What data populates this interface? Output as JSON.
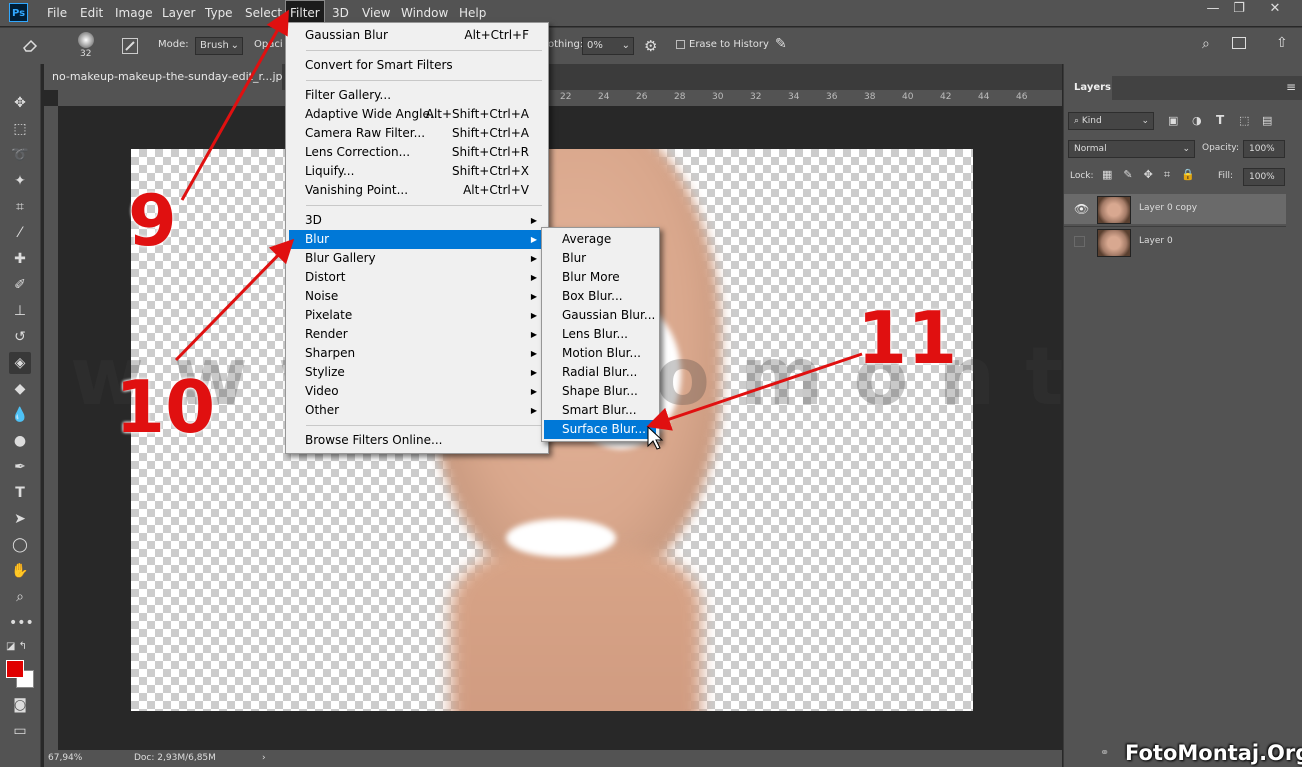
{
  "app": {
    "logo_text": "Ps"
  },
  "menubar": {
    "items": [
      "File",
      "Edit",
      "Image",
      "Layer",
      "Type",
      "Select",
      "Filter",
      "3D",
      "View",
      "Window",
      "Help"
    ],
    "active": "Filter"
  },
  "window_controls": {
    "minimize": "—",
    "restore": "❐",
    "close": "✕"
  },
  "options_bar": {
    "brush_size": "32",
    "mode_label": "Mode:",
    "mode_value": "Brush",
    "opacity_label": "Opaci",
    "smoothing_label": "othing:",
    "smoothing_value": "0%",
    "erase_history_label": "Erase to History"
  },
  "document": {
    "tab_title": "no-makeup-makeup-the-sunday-edit_r...jpg",
    "zoom": "67,94%",
    "doc_info": "Doc: 2,93M/6,85M"
  },
  "ruler_labels": [
    "22",
    "24",
    "26",
    "28",
    "30",
    "32",
    "34",
    "36",
    "38",
    "40",
    "42",
    "44",
    "46"
  ],
  "filter_menu": {
    "items": [
      {
        "label": "Gaussian Blur",
        "shortcut": "Alt+Ctrl+F",
        "submenu": false
      },
      {
        "sep": true
      },
      {
        "label": "Convert for Smart Filters",
        "shortcut": "",
        "submenu": false
      },
      {
        "sep": true
      },
      {
        "label": "Filter Gallery...",
        "shortcut": "",
        "submenu": false
      },
      {
        "label": "Adaptive Wide Angle...",
        "shortcut": "Alt+Shift+Ctrl+A",
        "submenu": false
      },
      {
        "label": "Camera Raw Filter...",
        "shortcut": "Shift+Ctrl+A",
        "submenu": false
      },
      {
        "label": "Lens Correction...",
        "shortcut": "Shift+Ctrl+R",
        "submenu": false
      },
      {
        "label": "Liquify...",
        "shortcut": "Shift+Ctrl+X",
        "submenu": false
      },
      {
        "label": "Vanishing Point...",
        "shortcut": "Alt+Ctrl+V",
        "submenu": false
      },
      {
        "sep": true
      },
      {
        "label": "3D",
        "shortcut": "",
        "submenu": true
      },
      {
        "label": "Blur",
        "shortcut": "",
        "submenu": true,
        "highlighted": true
      },
      {
        "label": "Blur Gallery",
        "shortcut": "",
        "submenu": true
      },
      {
        "label": "Distort",
        "shortcut": "",
        "submenu": true
      },
      {
        "label": "Noise",
        "shortcut": "",
        "submenu": true
      },
      {
        "label": "Pixelate",
        "shortcut": "",
        "submenu": true
      },
      {
        "label": "Render",
        "shortcut": "",
        "submenu": true
      },
      {
        "label": "Sharpen",
        "shortcut": "",
        "submenu": true
      },
      {
        "label": "Stylize",
        "shortcut": "",
        "submenu": true
      },
      {
        "label": "Video",
        "shortcut": "",
        "submenu": true
      },
      {
        "label": "Other",
        "shortcut": "",
        "submenu": true
      },
      {
        "sep": true
      },
      {
        "label": "Browse Filters Online...",
        "shortcut": "",
        "submenu": false
      }
    ]
  },
  "blur_submenu": {
    "items": [
      "Average",
      "Blur",
      "Blur More",
      "Box Blur...",
      "Gaussian Blur...",
      "Lens Blur...",
      "Motion Blur...",
      "Radial Blur...",
      "Shape Blur...",
      "Smart Blur...",
      "Surface Blur..."
    ],
    "highlighted": "Surface Blur..."
  },
  "layers_panel": {
    "tab": "Layers",
    "kind_label": "Kind",
    "blend_mode": "Normal",
    "opacity_label": "Opacity:",
    "opacity_value": "100%",
    "lock_label": "Lock:",
    "fill_label": "Fill:",
    "fill_value": "100%",
    "layers": [
      {
        "name": "Layer 0 copy",
        "visible": true,
        "selected": true
      },
      {
        "name": "Layer 0",
        "visible": false,
        "selected": false
      }
    ]
  },
  "annotations": {
    "step_9": "9",
    "step_10": "10",
    "step_11": "11",
    "watermark": "www.fotomontaj.org",
    "credit": "FotoMontaj.Org"
  },
  "colors": {
    "accent": "#0078d7",
    "annotation": "#e01010",
    "foreground_swatch": "#e00000",
    "background_swatch": "#ffffff"
  }
}
